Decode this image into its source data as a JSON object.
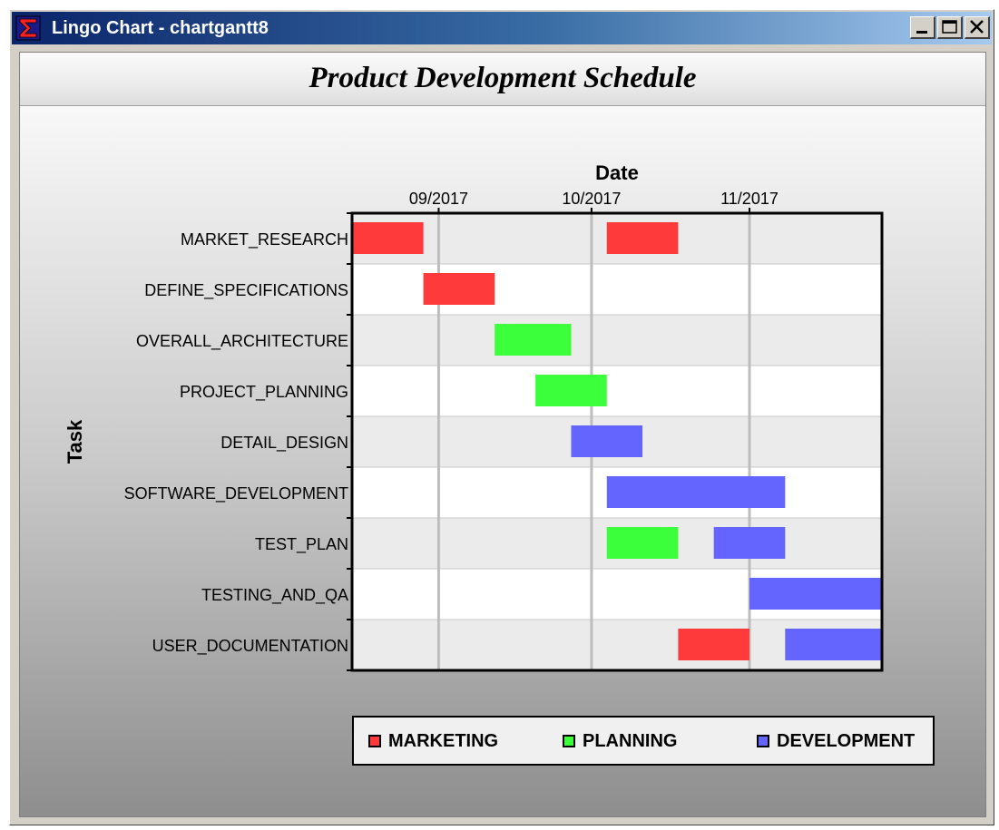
{
  "window": {
    "title": "Lingo Chart - chartgantt8",
    "icon": "sigma-app-icon",
    "controls": [
      "minimize-icon",
      "maximize-icon",
      "close-icon"
    ]
  },
  "chart_data": {
    "type": "gantt",
    "title": "Product Development Schedule",
    "xlabel": "Date",
    "ylabel": "Task",
    "x_ticks": [
      "09/2017",
      "10/2017",
      "11/2017"
    ],
    "x_range": [
      "2017-08-15",
      "2017-11-27"
    ],
    "grid": true,
    "legend_position": "bottom",
    "categories": [
      "MARKET_RESEARCH",
      "DEFINE_SPECIFICATIONS",
      "OVERALL_ARCHITECTURE",
      "PROJECT_PLANNING",
      "DETAIL_DESIGN",
      "SOFTWARE_DEVELOPMENT",
      "TEST_PLAN",
      "TESTING_AND_QA",
      "USER_DOCUMENTATION"
    ],
    "series": [
      {
        "name": "MARKETING",
        "color": "#ff3a3a"
      },
      {
        "name": "PLANNING",
        "color": "#3aff3a"
      },
      {
        "name": "DEVELOPMENT",
        "color": "#6464ff"
      }
    ],
    "bars": [
      {
        "task": "MARKET_RESEARCH",
        "series": "MARKETING",
        "start": "2017-08-15",
        "end": "2017-08-29"
      },
      {
        "task": "MARKET_RESEARCH",
        "series": "MARKETING",
        "start": "2017-10-04",
        "end": "2017-10-18"
      },
      {
        "task": "DEFINE_SPECIFICATIONS",
        "series": "MARKETING",
        "start": "2017-08-29",
        "end": "2017-09-12"
      },
      {
        "task": "OVERALL_ARCHITECTURE",
        "series": "PLANNING",
        "start": "2017-09-12",
        "end": "2017-09-27"
      },
      {
        "task": "PROJECT_PLANNING",
        "series": "PLANNING",
        "start": "2017-09-20",
        "end": "2017-10-04"
      },
      {
        "task": "DETAIL_DESIGN",
        "series": "DEVELOPMENT",
        "start": "2017-09-27",
        "end": "2017-10-11"
      },
      {
        "task": "SOFTWARE_DEVELOPMENT",
        "series": "DEVELOPMENT",
        "start": "2017-10-04",
        "end": "2017-11-08"
      },
      {
        "task": "TEST_PLAN",
        "series": "PLANNING",
        "start": "2017-10-04",
        "end": "2017-10-18"
      },
      {
        "task": "TEST_PLAN",
        "series": "DEVELOPMENT",
        "start": "2017-10-25",
        "end": "2017-11-08"
      },
      {
        "task": "TESTING_AND_QA",
        "series": "DEVELOPMENT",
        "start": "2017-11-01",
        "end": "2017-11-27"
      },
      {
        "task": "USER_DOCUMENTATION",
        "series": "MARKETING",
        "start": "2017-10-18",
        "end": "2017-11-01"
      },
      {
        "task": "USER_DOCUMENTATION",
        "series": "DEVELOPMENT",
        "start": "2017-11-08",
        "end": "2017-11-27"
      }
    ]
  }
}
